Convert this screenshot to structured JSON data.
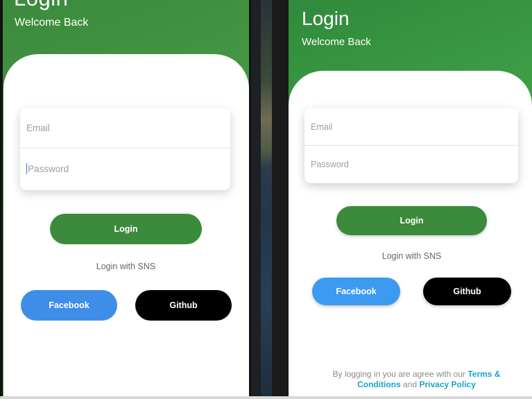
{
  "left_screen": {
    "title": "Login",
    "subtitle": "Welcome Back",
    "email_placeholder": "Email",
    "password_placeholder": "Password",
    "login_label": "Login",
    "sns_label": "Login with SNS",
    "facebook_label": "Facebook",
    "github_label": "Github"
  },
  "right_screen": {
    "title": "Login",
    "subtitle": "Welcome Back",
    "email_placeholder": "Email",
    "password_placeholder": "Password",
    "login_label": "Login",
    "sns_label": "Login with SNS",
    "facebook_label": "Facebook",
    "github_label": "Github",
    "terms": {
      "prefix": "By logging in you are agree with our",
      "terms_link": "Terms & Conditions",
      "and": "and",
      "privacy_link": "Privacy Policy"
    }
  },
  "colors": {
    "header_green": "#4a9e4a",
    "login_button": "#3c8a3c",
    "facebook_button": "#3e8ee8",
    "github_button": "#000000",
    "link": "#1aa3c7"
  }
}
